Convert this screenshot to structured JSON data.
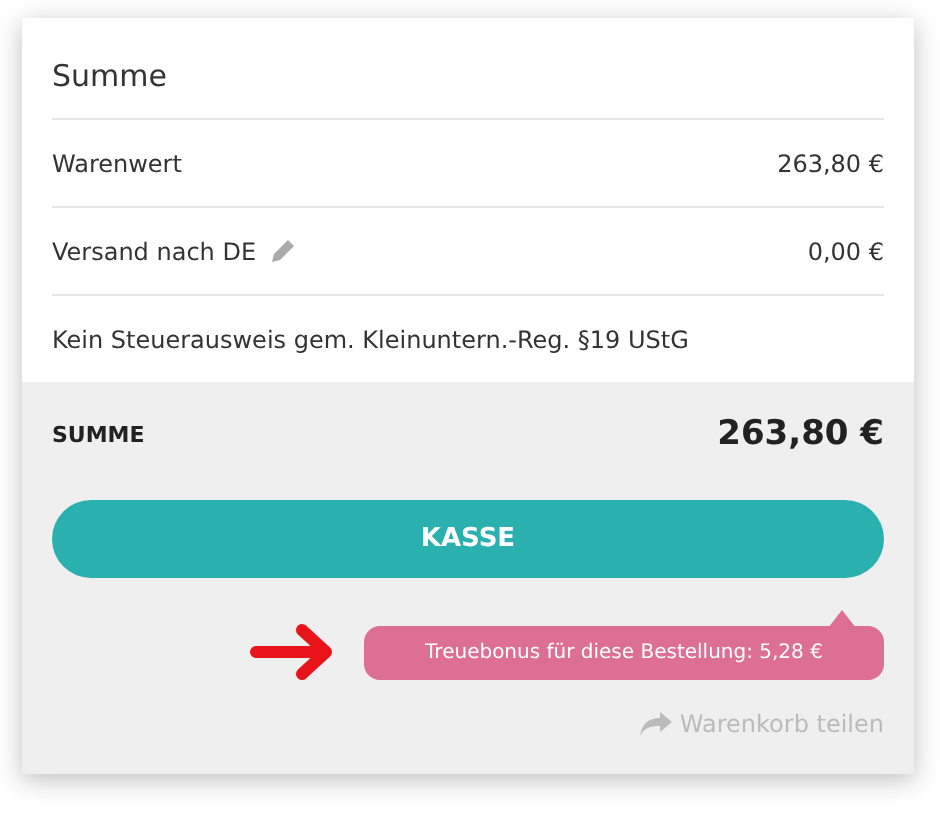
{
  "summary": {
    "title": "Summe",
    "rows": [
      {
        "kind": "amount",
        "label": "Warenwert",
        "value": "263,80 €",
        "editable": false
      },
      {
        "kind": "amount",
        "label": "Versand nach DE",
        "value": "0,00 €",
        "editable": true
      },
      {
        "kind": "note",
        "label": "Kein Steuerausweis gem. Kleinuntern.-Reg. §19 UStG"
      }
    ]
  },
  "total": {
    "label": "SUMME",
    "value": "263,80 €"
  },
  "checkout_button": "KASSE",
  "bonus_badge": "Treuebonus für diese Bestellung: 5,28 €",
  "share_link": "Warenkorb teilen"
}
